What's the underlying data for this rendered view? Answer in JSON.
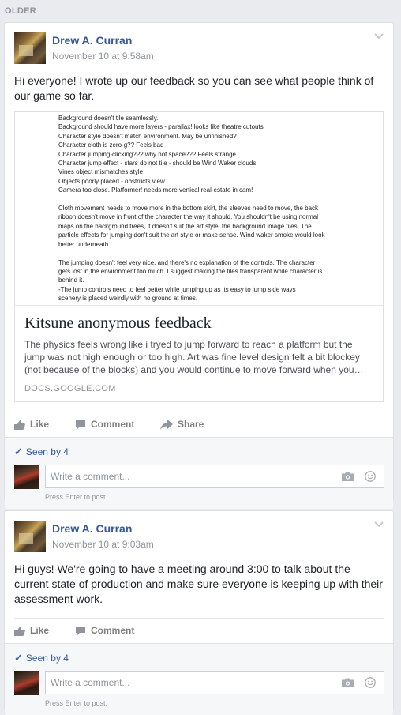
{
  "section_label": "OLDER",
  "posts": [
    {
      "author": "Drew A. Curran",
      "timestamp": "November 10 at 9:58am",
      "text": "Hi everyone! I wrote up our feedback so you can see what people think of our game so far.",
      "link": {
        "preview_lines": "Background doesn't tile seamlessly.\nBackground should have more layers - parallax! looks like theatre cutouts\nCharacter style doesn't match environment. May be unfinished?\nCharacter cloth is zero-g?? Feels bad\nCharacter jumping-clicking??? why not space??? Feels strange\nCharacter jump effect - stars do not tile - should be Wind Waker clouds!\nVines object mismatches style\nObjects poorly placed - obstructs view\nCamera too close. Platformer! needs more vertical real-estate in cam!\n\nCloth movement needs to move more in the bottom skirt, the sleeves need to move, the back\nribbon doesn't move in front of the character the way it should. You shouldn't be using normal\nmaps on the background trees, it doesn't suit the art style. the background image tiles. The\nparticle effects for jumping don't suit the art style or make sense. Wind waker smoke would look\nbetter underneath.\n\nThe jumping doesn't feel very nice, and there's no explanation of the controls. The character\ngets lost in the environment too much. I suggest making the tiles transparent while character is\nbehind it.\n-The jump controls need to feel better while jumping up as its easy to jump side ways\nscenery is placed weirdly with no ground at times.",
        "title": "Kitsune anonymous feedback",
        "description": "The physics feels wrong like i tryed to jump forward to reach a platform but the jump was not high enough or too high. Art was fine level design felt a bit blockey (not because of the blocks) and you would continue to move forward when you…",
        "domain": "DOCS.GOOGLE.COM"
      },
      "actions": {
        "like": "Like",
        "comment": "Comment",
        "share": "Share"
      },
      "seen": "Seen by 4",
      "comment_placeholder": "Write a comment...",
      "press_enter": "Press Enter to post."
    },
    {
      "author": "Drew A. Curran",
      "timestamp": "November 10 at 9:03am",
      "text": "Hi guys! We're going to have a meeting around 3:00 to talk about the current state of production and make sure everyone is keeping up with their assessment work.",
      "actions": {
        "like": "Like",
        "comment": "Comment"
      },
      "seen": "Seen by 4",
      "comment_placeholder": "Write a comment...",
      "press_enter": "Press Enter to post."
    }
  ],
  "colors": {
    "background": "#e9ebee",
    "author": "#365899",
    "muted": "#90949c",
    "seen_check": "#4267b2"
  }
}
